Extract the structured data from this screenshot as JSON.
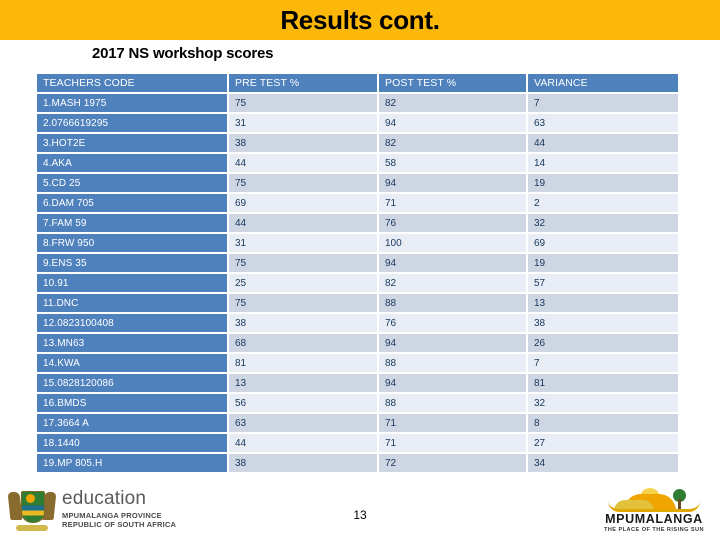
{
  "slide": {
    "title": "Results cont.",
    "subtitle": "2017 NS workshop scores",
    "page_number": "13",
    "banner_color": "#FBB809",
    "table_header_color": "#4F81BD"
  },
  "table": {
    "columns": [
      "TEACHERS CODE",
      "PRE TEST %",
      "POST TEST %",
      "VARIANCE"
    ],
    "rows": [
      {
        "code": "1.MASH 1975",
        "pre": "75",
        "post": "82",
        "variance": "7"
      },
      {
        "code": "2.0766619295",
        "pre": "31",
        "post": "94",
        "variance": "63"
      },
      {
        "code": "3.HOT2E",
        "pre": "38",
        "post": "82",
        "variance": "44"
      },
      {
        "code": "4.AKA",
        "pre": "44",
        "post": "58",
        "variance": "14"
      },
      {
        "code": "5.CD 25",
        "pre": "75",
        "post": "94",
        "variance": "19"
      },
      {
        "code": "6.DAM 705",
        "pre": "69",
        "post": "71",
        "variance": "2"
      },
      {
        "code": "7.FAM 59",
        "pre": "44",
        "post": "76",
        "variance": "32"
      },
      {
        "code": "8.FRW 950",
        "pre": "31",
        "post": "100",
        "variance": "69"
      },
      {
        "code": "9.ENS 35",
        "pre": "75",
        "post": "94",
        "variance": "19"
      },
      {
        "code": "10.91",
        "pre": "25",
        "post": "82",
        "variance": "57"
      },
      {
        "code": "11.DNC",
        "pre": "75",
        "post": "88",
        "variance": "13"
      },
      {
        "code": "12.0823100408",
        "pre": "38",
        "post": "76",
        "variance": "38"
      },
      {
        "code": "13.MN63",
        "pre": "68",
        "post": "94",
        "variance": "26"
      },
      {
        "code": "14.KWA",
        "pre": "81",
        "post": "88",
        "variance": "7"
      },
      {
        "code": "15.0828120086",
        "pre": "13",
        "post": "94",
        "variance": "81"
      },
      {
        "code": "16.BMDS",
        "pre": "56",
        "post": "88",
        "variance": "32"
      },
      {
        "code": "17.3664 A",
        "pre": "63",
        "post": "71",
        "variance": "8"
      },
      {
        "code": "18.1440",
        "pre": "44",
        "post": "71",
        "variance": "27"
      },
      {
        "code": "19.MP 805.H",
        "pre": "38",
        "post": "72",
        "variance": "34"
      }
    ]
  },
  "footer": {
    "education_logo": {
      "word": "education",
      "line1": "MPUMALANGA PROVINCE",
      "line2": "REPUBLIC OF SOUTH AFRICA"
    },
    "province_logo": {
      "name": "MPUMALANGA",
      "tagline": "THE PLACE OF THE RISING SUN"
    }
  }
}
